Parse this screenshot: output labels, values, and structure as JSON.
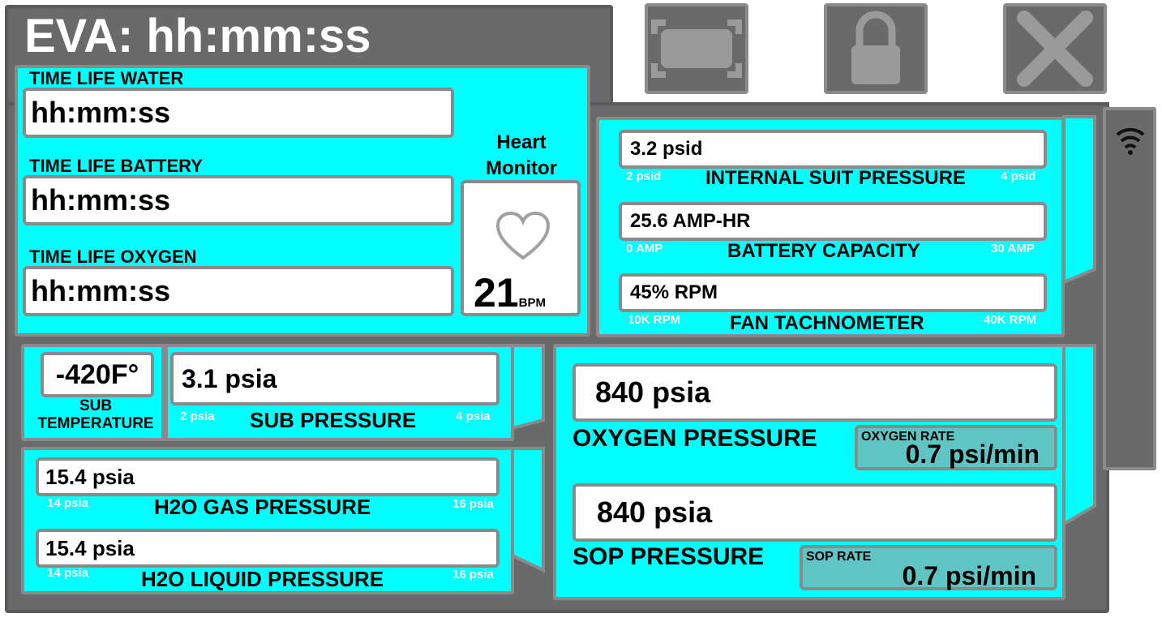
{
  "header": {
    "title": "EVA: hh:mm:ss"
  },
  "toolbar": {
    "icons": [
      "fullscreen-icon",
      "lock-icon",
      "close-icon"
    ]
  },
  "side_panel": {
    "icon": "wifi-icon"
  },
  "timers": [
    {
      "label": "TIME LIFE WATER",
      "value": "hh:mm:ss"
    },
    {
      "label": "TIME LIFE BATTERY",
      "value": "hh:mm:ss"
    },
    {
      "label": "TIME LIFE OXYGEN",
      "value": "hh:mm:ss"
    }
  ],
  "heart": {
    "title_line1": "Heart",
    "title_line2": "Monitor",
    "icon": "heart-icon",
    "value": "21",
    "unit": "BPM"
  },
  "suit": [
    {
      "value": "3.2 psid",
      "label": "INTERNAL SUIT PRESSURE",
      "min": "2 psid",
      "max": "4 psid"
    },
    {
      "value": "25.6 AMP-HR",
      "label": "BATTERY CAPACITY",
      "min": "0 AMP",
      "max": "30 AMP"
    },
    {
      "value": "45% RPM",
      "label": "FAN TACHNOMETER",
      "min": "10K RPM",
      "max": "40K RPM"
    }
  ],
  "sub": {
    "temp_value": "-420F°",
    "temp_label_1": "SUB",
    "temp_label_2": "TEMPERATURE",
    "pressure_value": "3.1 psia",
    "pressure_label": "SUB PRESSURE",
    "pressure_min": "2 psia",
    "pressure_max": "4 psia"
  },
  "h2o": [
    {
      "value": "15.4 psia",
      "label": "H2O GAS PRESSURE",
      "min": "14 psia",
      "max": "16 psia"
    },
    {
      "value": "15.4 psia",
      "label": "H2O LIQUID PRESSURE",
      "min": "14 psia",
      "max": "16 psia"
    }
  ],
  "oxygen": {
    "oxy_value": "840 psia",
    "oxy_label": "OXYGEN PRESSURE",
    "oxy_rate_label": "OXYGEN RATE",
    "oxy_rate_value": "0.7 psi/min",
    "sop_value": "840 psia",
    "sop_label": "SOP PRESSURE",
    "sop_rate_label": "SOP RATE",
    "sop_rate_value": "0.7 psi/min"
  },
  "colors": {
    "accent": "#00ffff",
    "panel": "#6a6a6a",
    "border": "#8a8a8a",
    "rate_bg": "#5fc4c4"
  }
}
